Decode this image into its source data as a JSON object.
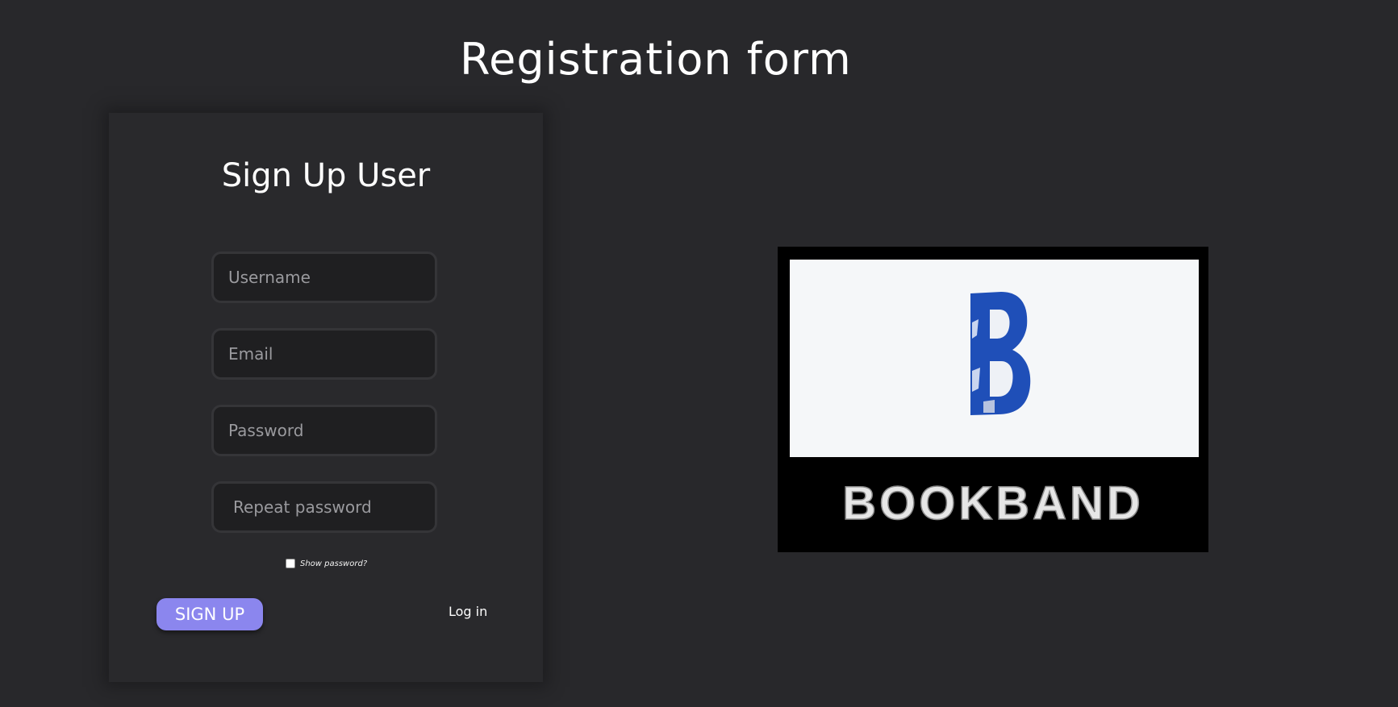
{
  "page": {
    "title": "Registration form"
  },
  "form": {
    "title": "Sign Up User",
    "fields": {
      "username": {
        "placeholder": "Username",
        "value": ""
      },
      "email": {
        "placeholder": "Email",
        "value": ""
      },
      "password": {
        "placeholder": "Password",
        "value": ""
      },
      "repeat_password": {
        "placeholder": "Repeat password",
        "value": ""
      }
    },
    "show_password": {
      "label": "Show password?",
      "checked": false
    },
    "signup_label": "SIGN UP",
    "login_label": "Log in"
  },
  "logo": {
    "letter": "B",
    "wordmark": "BOOKBAND"
  },
  "colors": {
    "background": "#28282b",
    "card": "#29292c",
    "input_bg": "#1f1f21",
    "accent_button": "#8b86ee",
    "logo_blue": "#1f4fb8"
  }
}
